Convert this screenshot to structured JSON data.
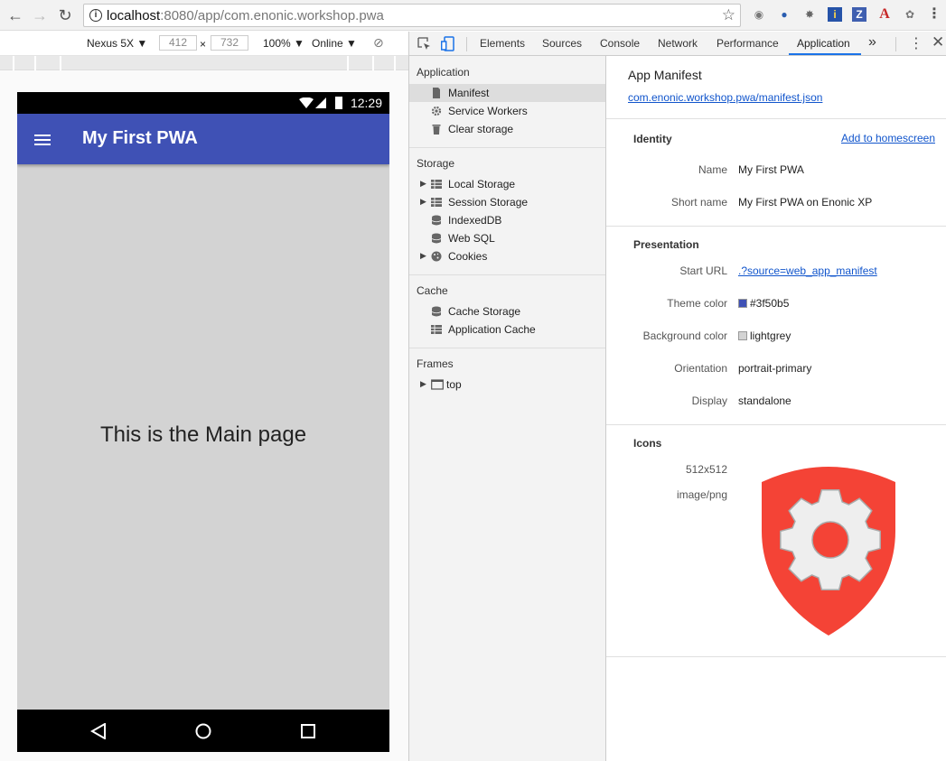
{
  "browser": {
    "url_host": "localhost",
    "url_rest": ":8080/app/com.enonic.workshop.pwa"
  },
  "device_toolbar": {
    "device": "Nexus 5X",
    "width": "412",
    "height": "732",
    "times": "×",
    "zoom": "100%",
    "network": "Online"
  },
  "phone": {
    "time": "12:29",
    "app_title": "My First PWA",
    "main_text": "This is the Main page",
    "theme_color": "#3f51b5",
    "background_color": "#d3d3d3"
  },
  "devtools": {
    "tabs": [
      "Elements",
      "Sources",
      "Console",
      "Network",
      "Performance",
      "Application"
    ],
    "active_tab": "Application",
    "more": "»"
  },
  "sidebar": {
    "application_header": "Application",
    "application_items": [
      "Manifest",
      "Service Workers",
      "Clear storage"
    ],
    "storage_header": "Storage",
    "storage_items": [
      "Local Storage",
      "Session Storage",
      "IndexedDB",
      "Web SQL",
      "Cookies"
    ],
    "cache_header": "Cache",
    "cache_items": [
      "Cache Storage",
      "Application Cache"
    ],
    "frames_header": "Frames",
    "frames_items": [
      "top"
    ]
  },
  "manifest": {
    "title": "App Manifest",
    "link": "com.enonic.workshop.pwa/manifest.json",
    "identity": {
      "header": "Identity",
      "add_home": "Add to homescreen",
      "name_label": "Name",
      "name_value": "My First PWA",
      "short_label": "Short name",
      "short_value": "My First PWA on Enonic XP"
    },
    "presentation": {
      "header": "Presentation",
      "start_label": "Start URL",
      "start_value": ".?source=web_app_manifest",
      "theme_label": "Theme color",
      "theme_value": "#3f50b5",
      "bg_label": "Background color",
      "bg_value": "lightgrey",
      "orient_label": "Orientation",
      "orient_value": "portrait-primary",
      "display_label": "Display",
      "display_value": "standalone"
    },
    "icons": {
      "header": "Icons",
      "size": "512x512",
      "type": "image/png",
      "icon_color": "#f44336"
    }
  }
}
